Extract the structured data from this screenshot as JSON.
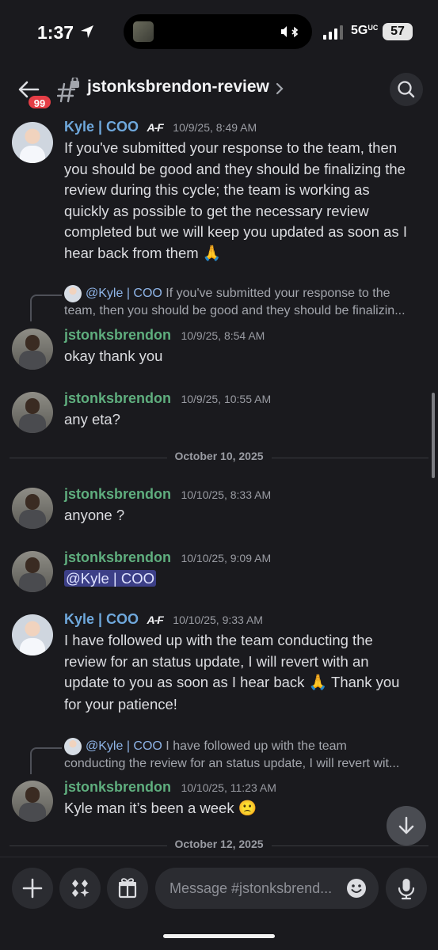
{
  "status_bar": {
    "time": "1:37",
    "network": "5G",
    "network_suffix": "UC",
    "battery": "57"
  },
  "header": {
    "back_badge": "99",
    "channel_name": "jstonksbrendon-review"
  },
  "messages": [
    {
      "author": "Kyle | COO",
      "tag": "A-F",
      "timestamp": "10/9/25, 8:49 AM",
      "lines": [
        "If you've submitted your response to the team, then",
        "you should be good and they should be finalizing the",
        "review during this cycle; the team is working as",
        "quickly as possible to get the necessary review",
        "completed but we will keep you updated as soon as I",
        "hear back from them"
      ],
      "emoji": "🙏"
    },
    {
      "reply_mention": "@Kyle | COO",
      "reply_text": " If you've submitted your response to the",
      "reply_line2": "team, then you should be good and they should be finalizin...",
      "author": "jstonksbrendon",
      "timestamp": "10/9/25, 8:54 AM",
      "text": "okay thank you"
    },
    {
      "author": "jstonksbrendon",
      "timestamp": "10/9/25, 10:55 AM",
      "text": "any eta?"
    },
    {
      "author": "jstonksbrendon",
      "timestamp": "10/10/25, 8:33 AM",
      "text": "anyone ?"
    },
    {
      "author": "jstonksbrendon",
      "timestamp": "10/10/25, 9:09 AM",
      "mention": "@Kyle | COO"
    },
    {
      "author": "Kyle | COO",
      "tag": "A-F",
      "timestamp": "10/10/25, 9:33 AM",
      "lines": [
        "I have followed up with the team conducting the",
        "review for an status update, I will revert with an",
        "update to you as soon as I hear back",
        "for your patience!"
      ],
      "line3_after": " Thank you",
      "emoji": "🙏"
    },
    {
      "reply_mention": "@Kyle | COO",
      "reply_text": " I have followed up with the team",
      "reply_line2": "conducting the review for an status update, I will revert wit...",
      "author": "jstonksbrendon",
      "timestamp": "10/10/25, 11:23 AM",
      "text": "Kyle man it’s been a week",
      "emoji": "🙁"
    }
  ],
  "dividers": [
    "October 10, 2025",
    "October 12, 2025"
  ],
  "composer": {
    "placeholder": "Message #jstonksbrend..."
  },
  "colors": {
    "background": "#1a1a1e",
    "kyle_name": "#6fa8dc",
    "jstonks_name": "#5fae7e",
    "mention_bg": "#3c3f87",
    "badge": "#e53e46"
  },
  "icons": [
    "location-arrow-icon",
    "bluetooth-icon",
    "signal-icon",
    "back-arrow-icon",
    "private-channel-icon",
    "chevron-right-icon",
    "search-icon",
    "jump-to-present-icon",
    "plus-icon",
    "apps-icon",
    "gift-icon",
    "emoji-icon",
    "microphone-icon"
  ]
}
